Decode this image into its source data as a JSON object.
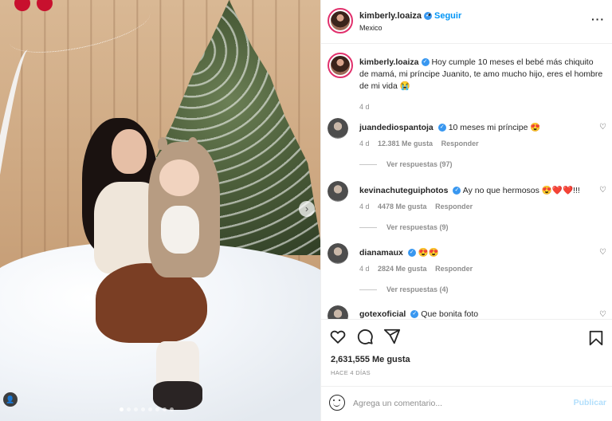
{
  "header": {
    "username": "kimberly.loaiza",
    "separator": "•",
    "follow_label": "Seguir",
    "location": "Mexico",
    "more_label": "···"
  },
  "caption": {
    "username": "kimberly.loaiza",
    "text": "Hoy cumple 10 meses el bebé más chiquito de mamá, mi príncipe Juanito, te amo mucho hijo, eres el hombre de mi vida 😭",
    "time": "4 d"
  },
  "comments": [
    {
      "username": "juandediospantoja",
      "text": "10 meses mi príncipe 😍",
      "time": "4 d",
      "likes": "12.381 Me gusta",
      "reply_label": "Responder",
      "replies": "Ver respuestas (97)"
    },
    {
      "username": "kevinachuteguiphotos",
      "text": "Ay no que hermosos 😍❤️❤️!!!",
      "time": "4 d",
      "likes": "4478 Me gusta",
      "reply_label": "Responder",
      "replies": "Ver respuestas (9)"
    },
    {
      "username": "dianamaux",
      "text": "😍😍",
      "time": "4 d",
      "likes": "2824 Me gusta",
      "reply_label": "Responder",
      "replies": "Ver respuestas (4)"
    },
    {
      "username": "gotexoficial",
      "text": "Que bonita foto",
      "time": "",
      "likes": "",
      "reply_label": "",
      "replies": ""
    }
  ],
  "actions": {
    "icons": [
      "heart-icon",
      "comment-icon",
      "share-icon",
      "bookmark-icon"
    ],
    "likes": "2,631,555 Me gusta",
    "posted": "HACE 4 DÍAS"
  },
  "composer": {
    "placeholder": "Agrega un comentario...",
    "publish_label": "Publicar"
  },
  "photo": {
    "arrow": "›",
    "tag_glyph": "👤"
  },
  "colors": {
    "accent": "#0095f6",
    "verified": "#3897f0",
    "muted": "#8e8e8e",
    "publish_disabled": "#b2dffc"
  }
}
